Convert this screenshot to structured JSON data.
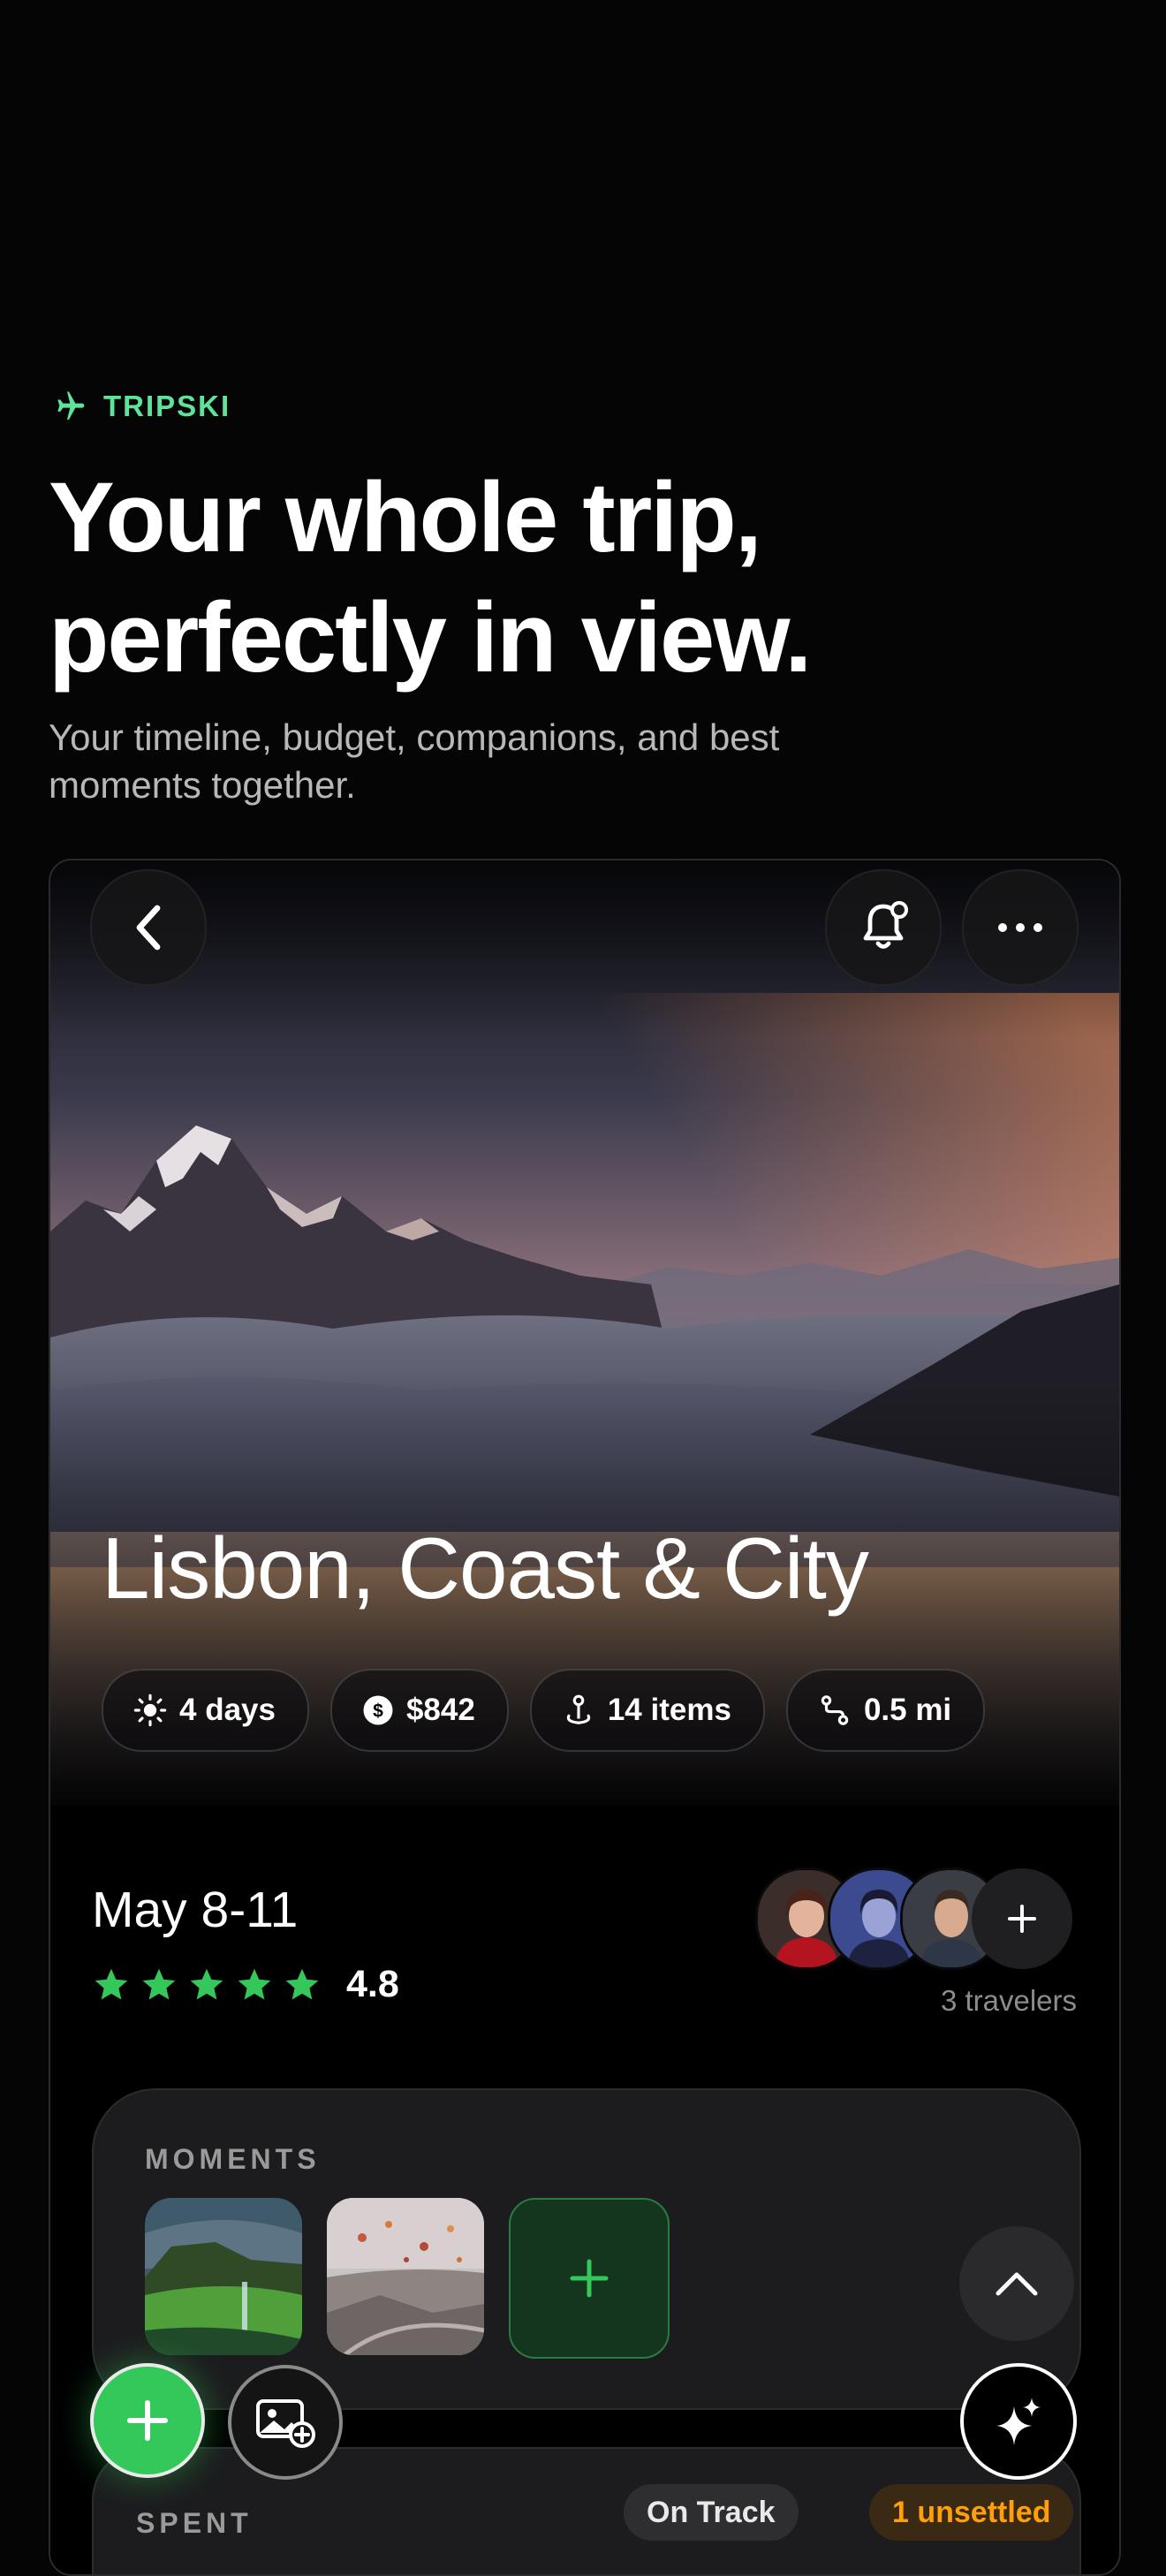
{
  "brand": {
    "name": "TRIPSKI",
    "icon": "airplane-icon",
    "color": "#5fe39a"
  },
  "headline": {
    "line1": "Your whole trip,",
    "line2": "perfectly in view."
  },
  "subtitle": "Your timeline, budget, companions, and best moments together.",
  "trip": {
    "title": "Lisbon, Coast & City",
    "chips": [
      {
        "icon": "sun-icon",
        "label": "4 days"
      },
      {
        "icon": "dollar-icon",
        "label": "$842"
      },
      {
        "icon": "map-pin-icon",
        "label": "14 items"
      },
      {
        "icon": "route-icon",
        "label": "0.5 mi"
      }
    ],
    "date": "May 8-11",
    "rating": "4.8",
    "rating_stars": 5,
    "travelers_label": "3 travelers"
  },
  "moments": {
    "label": "MOMENTS"
  },
  "spent": {
    "label": "SPENT",
    "status": "On Track",
    "unsettled": "1 unsettled"
  },
  "colors": {
    "accent_green": "#34c759",
    "warning_orange": "#ff9f0a",
    "background": "#050505"
  }
}
